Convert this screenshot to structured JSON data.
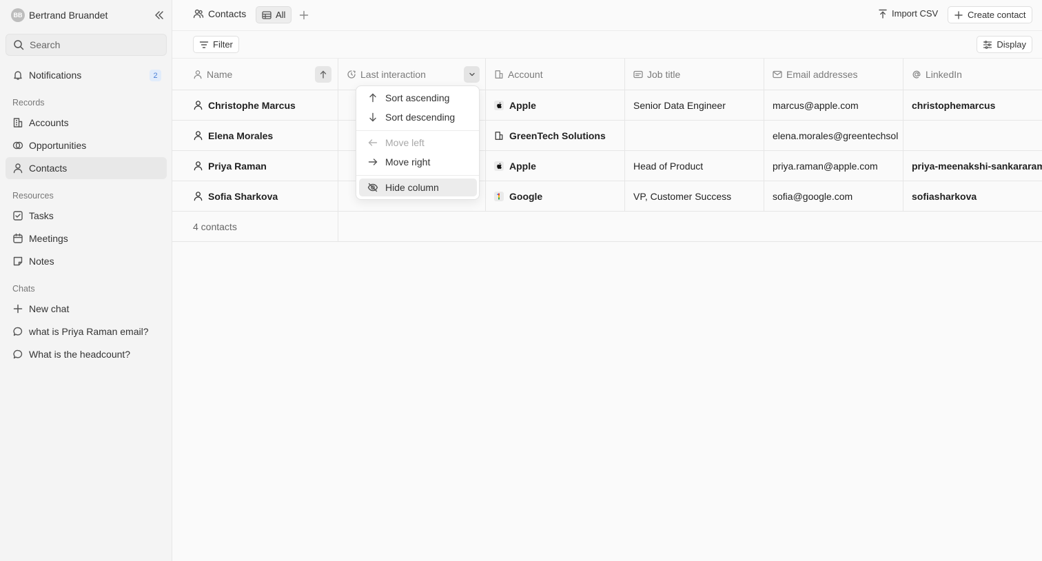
{
  "sidebar": {
    "user": {
      "initials": "BB",
      "name": "Bertrand Bruandet"
    },
    "search": {
      "placeholder": "Search"
    },
    "notifications": {
      "label": "Notifications",
      "count": "2"
    },
    "records_heading": "Records",
    "records": [
      {
        "label": "Accounts",
        "icon": "building-icon"
      },
      {
        "label": "Opportunities",
        "icon": "opportunities-icon"
      },
      {
        "label": "Contacts",
        "icon": "person-icon",
        "active": true
      }
    ],
    "resources_heading": "Resources",
    "resources": [
      {
        "label": "Tasks",
        "icon": "checkbox-icon"
      },
      {
        "label": "Meetings",
        "icon": "calendar-icon"
      },
      {
        "label": "Notes",
        "icon": "note-icon"
      }
    ],
    "chats_heading": "Chats",
    "chats": [
      {
        "label": "New chat",
        "icon": "plus-icon"
      },
      {
        "label": "what is Priya Raman email?",
        "icon": "chat-bubble-icon"
      },
      {
        "label": "What is the headcount?",
        "icon": "chat-bubble-icon"
      }
    ]
  },
  "topbar": {
    "title": "Contacts",
    "view": "All",
    "import_label": "Import CSV",
    "create_label": "Create contact"
  },
  "filterbar": {
    "filter_label": "Filter",
    "display_label": "Display"
  },
  "table": {
    "columns": [
      "Name",
      "Last interaction",
      "Account",
      "Job title",
      "Email addresses",
      "LinkedIn"
    ],
    "rows": [
      {
        "name": "Christophe Marcus",
        "last_interaction": "",
        "account": "Apple",
        "account_logo": "",
        "job_title": "Senior Data Engineer",
        "email": "marcus@apple.com",
        "linkedin": "christophemarcus"
      },
      {
        "name": "Elena Morales",
        "last_interaction": "",
        "account": "GreenTech Solutions",
        "account_logo": "building-icon",
        "job_title": "",
        "email": "elena.morales@greentechsol",
        "linkedin": ""
      },
      {
        "name": "Priya Raman",
        "last_interaction": "",
        "account": "Apple",
        "account_logo": "",
        "job_title": "Head of Product",
        "email": "priya.raman@apple.com",
        "linkedin": "priya-meenakshi-sankararam"
      },
      {
        "name": "Sofia Sharkova",
        "last_interaction": "",
        "account": "Google",
        "account_logo": "",
        "job_title": "VP, Customer Success",
        "email": "sofia@google.com",
        "linkedin": "sofiasharkova"
      }
    ],
    "footer": "4 contacts"
  },
  "column_menu": {
    "items": [
      {
        "label": "Sort ascending",
        "icon": "arrow-up-icon"
      },
      {
        "label": "Sort descending",
        "icon": "arrow-down-icon"
      },
      {
        "label": "Move left",
        "icon": "arrow-left-icon",
        "disabled": true
      },
      {
        "label": "Move right",
        "icon": "arrow-right-icon"
      },
      {
        "label": "Hide column",
        "icon": "eye-off-icon"
      }
    ]
  },
  "colors": {
    "badge_bg": "#e1ecfb",
    "badge_text": "#4a7fd6",
    "active_nav_bg": "#e8e8e8"
  }
}
